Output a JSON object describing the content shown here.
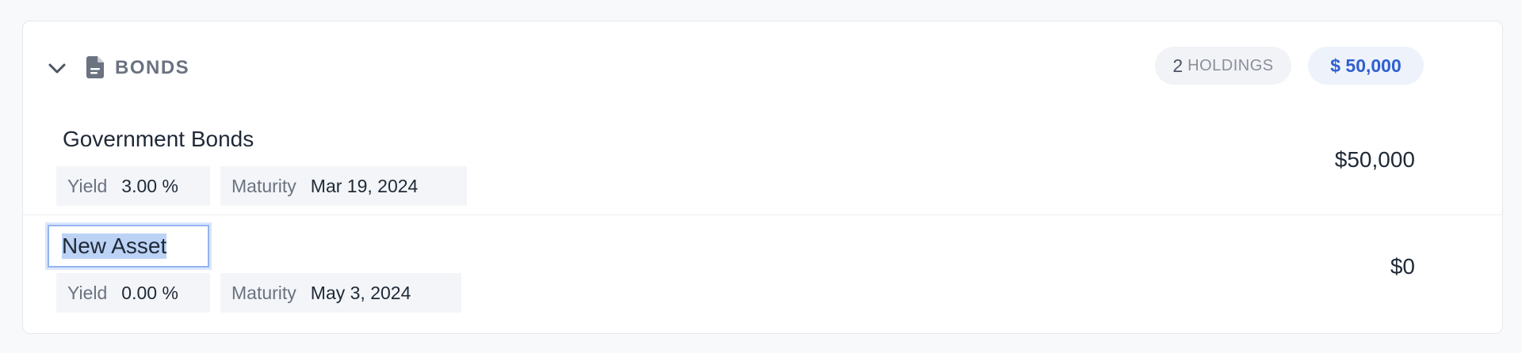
{
  "section": {
    "title": "BONDS",
    "expanded": true,
    "holdings_count": "2",
    "holdings_label": "HOLDINGS",
    "total": "$ 50,000",
    "icons": {
      "toggle": "chevron-down-icon",
      "category": "document-icon"
    }
  },
  "assets": [
    {
      "name": "Government Bonds",
      "yield_label": "Yield",
      "yield_value": "3.00 %",
      "maturity_label": "Maturity",
      "maturity_value": "Mar 19, 2024",
      "value": "$50,000"
    },
    {
      "name": "New Asset",
      "name_editing": true,
      "yield_label": "Yield",
      "yield_value": "0.00 %",
      "maturity_label": "Maturity",
      "maturity_value": "May 3, 2024",
      "value": "$0"
    }
  ],
  "colors": {
    "accent": "#2f5fd0",
    "muted_text": "#6b7280",
    "chip_bg": "#f3f5f8",
    "selection": "#bcd3f5",
    "focus_border": "#93b4ef"
  }
}
